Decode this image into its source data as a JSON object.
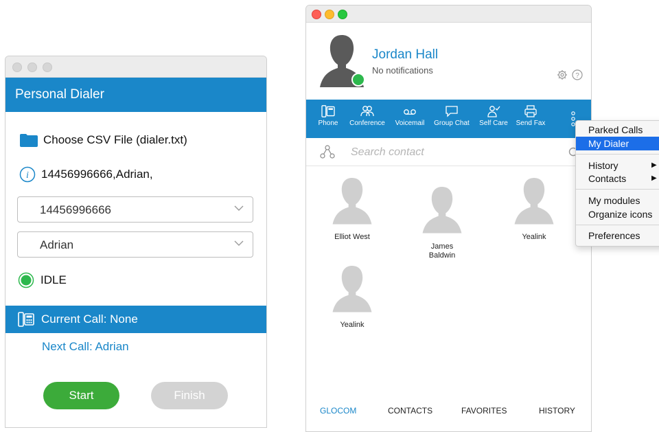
{
  "dialer": {
    "title": "Personal Dialer",
    "csv_label": "Choose CSV File (dialer.txt)",
    "info_text": "14456996666,Adrian,",
    "number_select": "14456996666",
    "name_select": "Adrian",
    "status": "IDLE",
    "current_call": "Current Call: None",
    "next_call": "Next Call: Adrian",
    "start_label": "Start",
    "finish_label": "Finish"
  },
  "glocom": {
    "user_name": "Jordan Hall",
    "notifications": "No notifications",
    "toolbar": [
      "Phone",
      "Conference",
      "Voicemail",
      "Group Chat",
      "Self Care",
      "Send Fax"
    ],
    "search_placeholder": "Search contact",
    "contacts": [
      "Elliot West",
      "James\nBaldwin",
      "Yealink",
      "Yealink"
    ],
    "tabs": [
      "GLOCOM",
      "CONTACTS",
      "FAVORITES",
      "HISTORY"
    ]
  },
  "menu": {
    "items": [
      "Parked Calls",
      "My Dialer",
      "History",
      "Contacts",
      "My modules",
      "Organize icons",
      "Preferences"
    ],
    "selected": "My Dialer"
  },
  "colors": {
    "accent": "#1a87c9",
    "status_green": "#2db84d",
    "start_green": "#3cab3a",
    "finish_gray": "#d3d3d3",
    "menu_selection": "#1c6ee8"
  }
}
